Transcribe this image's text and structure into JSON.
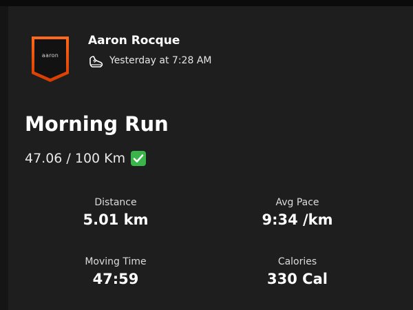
{
  "athlete": {
    "avatar_text": "aaron",
    "name": "Aaron Rocque",
    "activity_icon": "shoe-icon",
    "timestamp": "Yesterday at 7:28 AM"
  },
  "activity": {
    "title": "Morning Run",
    "goal_progress": "47.06 / 100 Km",
    "goal_icon": "check-mark-icon"
  },
  "stats": [
    {
      "label": "Distance",
      "value": "5.01 km"
    },
    {
      "label": "Avg Pace",
      "value": "9:34 /km"
    },
    {
      "label": "Moving Time",
      "value": "47:59"
    },
    {
      "label": "Calories",
      "value": "330 Cal"
    }
  ],
  "colors": {
    "background": "#1e1e1e",
    "accent_orange": "#fc4c02",
    "check_green": "#39b54a"
  }
}
